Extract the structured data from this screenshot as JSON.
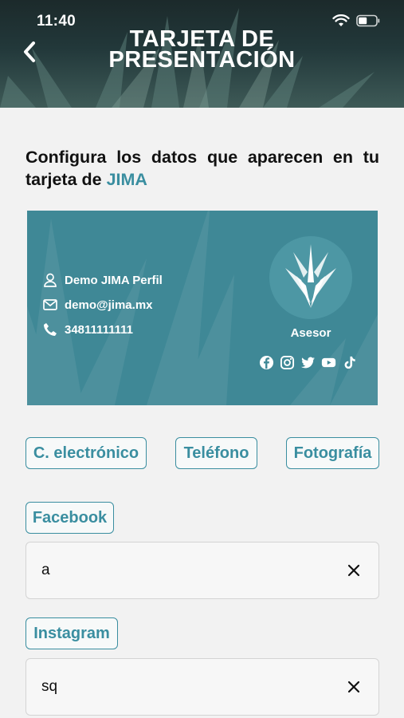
{
  "status_bar": {
    "time": "11:40"
  },
  "header": {
    "title_line1": "TARJETA DE",
    "title_line2": "PRESENTACIÓN"
  },
  "intro": {
    "text": "Configura los datos que aparecen en tu tarjeta de ",
    "brand": "JIMA"
  },
  "card": {
    "name": "Demo JIMA Perfil",
    "email": "demo@jima.mx",
    "phone": "34811111111",
    "role": "Asesor",
    "socials": [
      "facebook-icon",
      "instagram-icon",
      "twitter-icon",
      "youtube-icon",
      "tiktok-icon"
    ],
    "colors": {
      "background": "#3f8896",
      "accent": "#3a8ea0"
    }
  },
  "toggles": {
    "email": "C. electrónico",
    "phone": "Teléfono",
    "photo": "Fotografía"
  },
  "fields": [
    {
      "label": "Facebook",
      "value": "a"
    },
    {
      "label": "Instagram",
      "value": "sq"
    }
  ]
}
